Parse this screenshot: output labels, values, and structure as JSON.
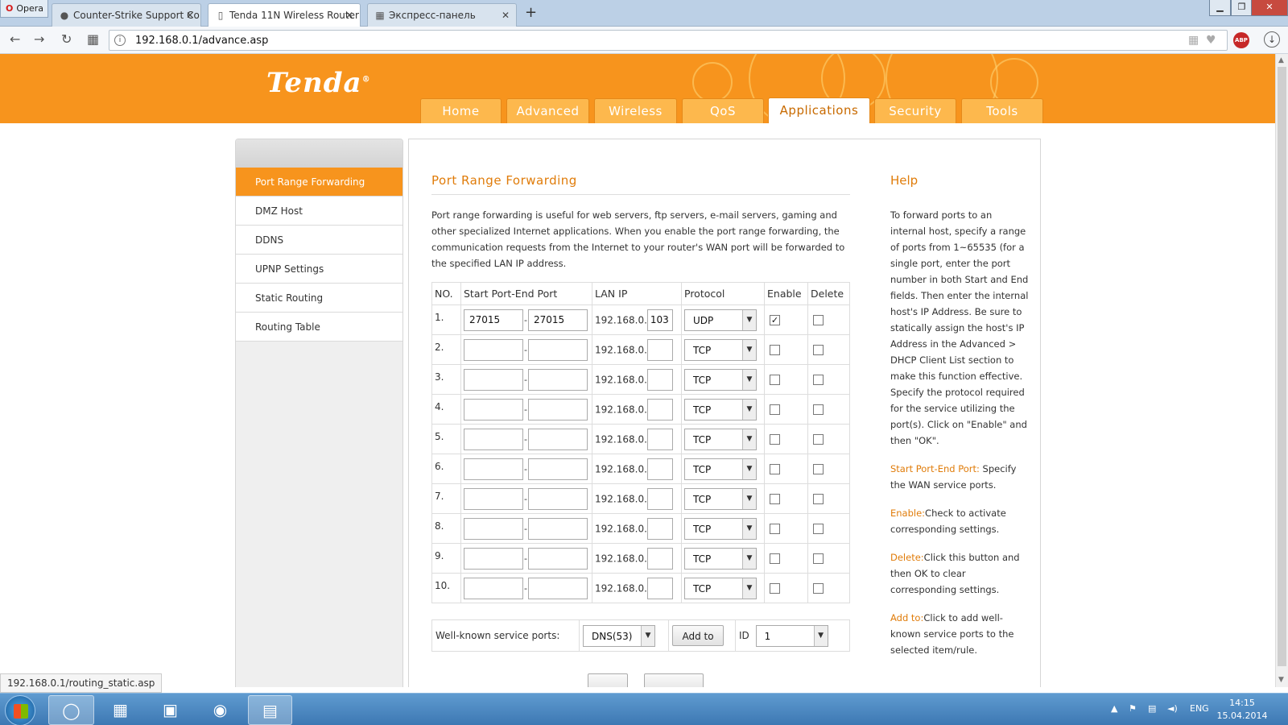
{
  "browser": {
    "menu_label": "Opera",
    "tabs": [
      {
        "title": "Counter-Strike Support Co",
        "icon": "avatar-icon"
      },
      {
        "title": "Tenda 11N Wireless Router",
        "icon": "page-icon"
      },
      {
        "title": "Экспресс-панель",
        "icon": "grid-icon"
      }
    ],
    "url": "192.168.0.1/advance.asp",
    "status_url": "192.168.0.1/routing_static.asp"
  },
  "header": {
    "logo": "Tenda",
    "nav": [
      "Home",
      "Advanced",
      "Wireless",
      "QoS",
      "Applications",
      "Security",
      "Tools"
    ],
    "active_nav": "Applications"
  },
  "sidebar": {
    "items": [
      "Port Range Forwarding",
      "DMZ Host",
      "DDNS",
      "UPNP Settings",
      "Static Routing",
      "Routing Table"
    ],
    "active": "Port Range Forwarding"
  },
  "main": {
    "title": "Port Range Forwarding",
    "description": "Port range forwarding is useful for web servers, ftp servers, e-mail servers, gaming and other specialized Internet applications. When you enable the port range forwarding, the communication requests from the Internet to your router's WAN port will be forwarded to the specified LAN IP address.",
    "columns": [
      "NO.",
      "Start Port-End Port",
      "LAN IP",
      "Protocol",
      "Enable",
      "Delete"
    ],
    "ip_prefix": "192.168.0.",
    "rows": [
      {
        "no": "1.",
        "start": "27015",
        "end": "27015",
        "ip": "103",
        "protocol": "UDP",
        "enabled": true,
        "delete": false
      },
      {
        "no": "2.",
        "start": "",
        "end": "",
        "ip": "",
        "protocol": "TCP",
        "enabled": false,
        "delete": false
      },
      {
        "no": "3.",
        "start": "",
        "end": "",
        "ip": "",
        "protocol": "TCP",
        "enabled": false,
        "delete": false
      },
      {
        "no": "4.",
        "start": "",
        "end": "",
        "ip": "",
        "protocol": "TCP",
        "enabled": false,
        "delete": false
      },
      {
        "no": "5.",
        "start": "",
        "end": "",
        "ip": "",
        "protocol": "TCP",
        "enabled": false,
        "delete": false
      },
      {
        "no": "6.",
        "start": "",
        "end": "",
        "ip": "",
        "protocol": "TCP",
        "enabled": false,
        "delete": false
      },
      {
        "no": "7.",
        "start": "",
        "end": "",
        "ip": "",
        "protocol": "TCP",
        "enabled": false,
        "delete": false
      },
      {
        "no": "8.",
        "start": "",
        "end": "",
        "ip": "",
        "protocol": "TCP",
        "enabled": false,
        "delete": false
      },
      {
        "no": "9.",
        "start": "",
        "end": "",
        "ip": "",
        "protocol": "TCP",
        "enabled": false,
        "delete": false
      },
      {
        "no": "10.",
        "start": "",
        "end": "",
        "ip": "",
        "protocol": "TCP",
        "enabled": false,
        "delete": false
      }
    ],
    "wellknown_label": "Well-known service ports:",
    "wellknown_value": "DNS(53)",
    "add_button": "Add to",
    "id_label": "ID",
    "id_value": "1"
  },
  "help": {
    "title": "Help",
    "intro": "To forward ports to an internal host, specify a range of ports from 1~65535 (for a single port, enter the port number in both Start and End fields. Then enter the internal host's IP Address. Be sure to statically assign the host's IP Address in the Advanced > DHCP Client List section to make this function effective. Specify the protocol required for the service utilizing the port(s). Click on \"Enable\" and then \"OK\".",
    "items": [
      {
        "key": "Start Port-End Port:",
        "text": " Specify the WAN service ports."
      },
      {
        "key": "Enable:",
        "text": "Check to activate corresponding settings."
      },
      {
        "key": "Delete:",
        "text": "Click this button and then OK to clear corresponding settings."
      },
      {
        "key": "Add to:",
        "text": "Click to add well-known service ports to the selected item/rule."
      }
    ]
  },
  "taskbar": {
    "lang": "ENG",
    "time": "14:15",
    "date": "15.04.2014"
  },
  "colors": {
    "brand": "#f7941d",
    "accent_text": "#e07c0a"
  }
}
